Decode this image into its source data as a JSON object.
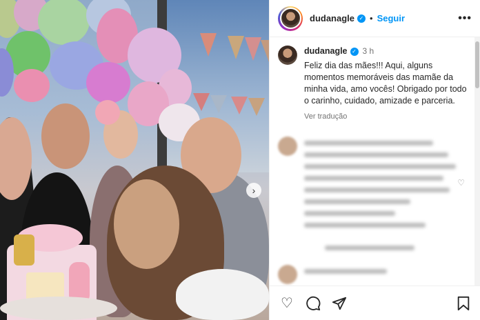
{
  "post": {
    "username": "dudanagle",
    "follow_label": "Seguir",
    "separator": "•",
    "more_label": "•••",
    "caption_username": "dudanagle",
    "time": "3 h",
    "caption_text": "Feliz dia das mães!!! Aqui, alguns momentos memoráveis das mamãe da minha vida, amo vocês! Obrigado por todo o carinho, cuidado, amizade e parceria.",
    "translate_label": "Ver tradução"
  },
  "icons": {
    "verified": "verified-badge-icon",
    "next": "chevron-right-icon",
    "heart": "heart-icon",
    "comment": "comment-icon",
    "share": "share-icon",
    "save": "bookmark-icon"
  },
  "colors": {
    "link_blue": "#0095f6",
    "text": "#262626",
    "muted": "#737373"
  }
}
